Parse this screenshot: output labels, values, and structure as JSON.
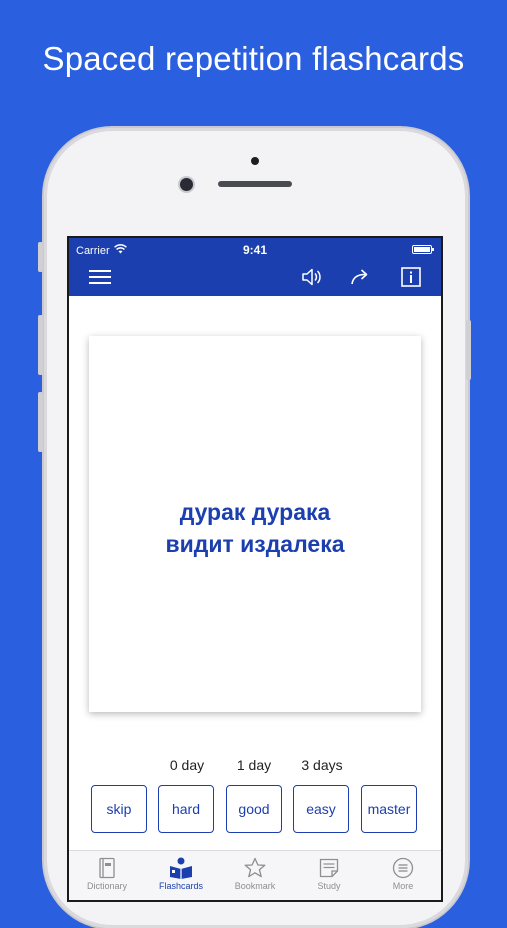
{
  "headline": "Spaced repetition flashcards",
  "status_bar": {
    "carrier": "Carrier",
    "time": "9:41"
  },
  "toolbar": {
    "menu_icon": "hamburger-menu-icon",
    "speaker_icon": "speaker-icon",
    "share_icon": "share-arrow-icon",
    "info_icon": "info-icon"
  },
  "card": {
    "line1": "дурак дурака",
    "line2": "видит издалека"
  },
  "intervals": [
    "0 day",
    "1 day",
    "3 days"
  ],
  "answers": {
    "skip": "skip",
    "hard": "hard",
    "good": "good",
    "easy": "easy",
    "master": "master"
  },
  "tabs": [
    {
      "label": "Dictionary",
      "icon": "book-icon",
      "active": false
    },
    {
      "label": "Flashcards",
      "icon": "flashcards-reader-icon",
      "active": true
    },
    {
      "label": "Bookmark",
      "icon": "star-icon",
      "active": false
    },
    {
      "label": "Study",
      "icon": "notepad-icon",
      "active": false
    },
    {
      "label": "More",
      "icon": "more-menu-icon",
      "active": false
    }
  ],
  "colors": {
    "background": "#2a5fdf",
    "primary": "#1b3fae",
    "inactive": "#8e8e93"
  }
}
